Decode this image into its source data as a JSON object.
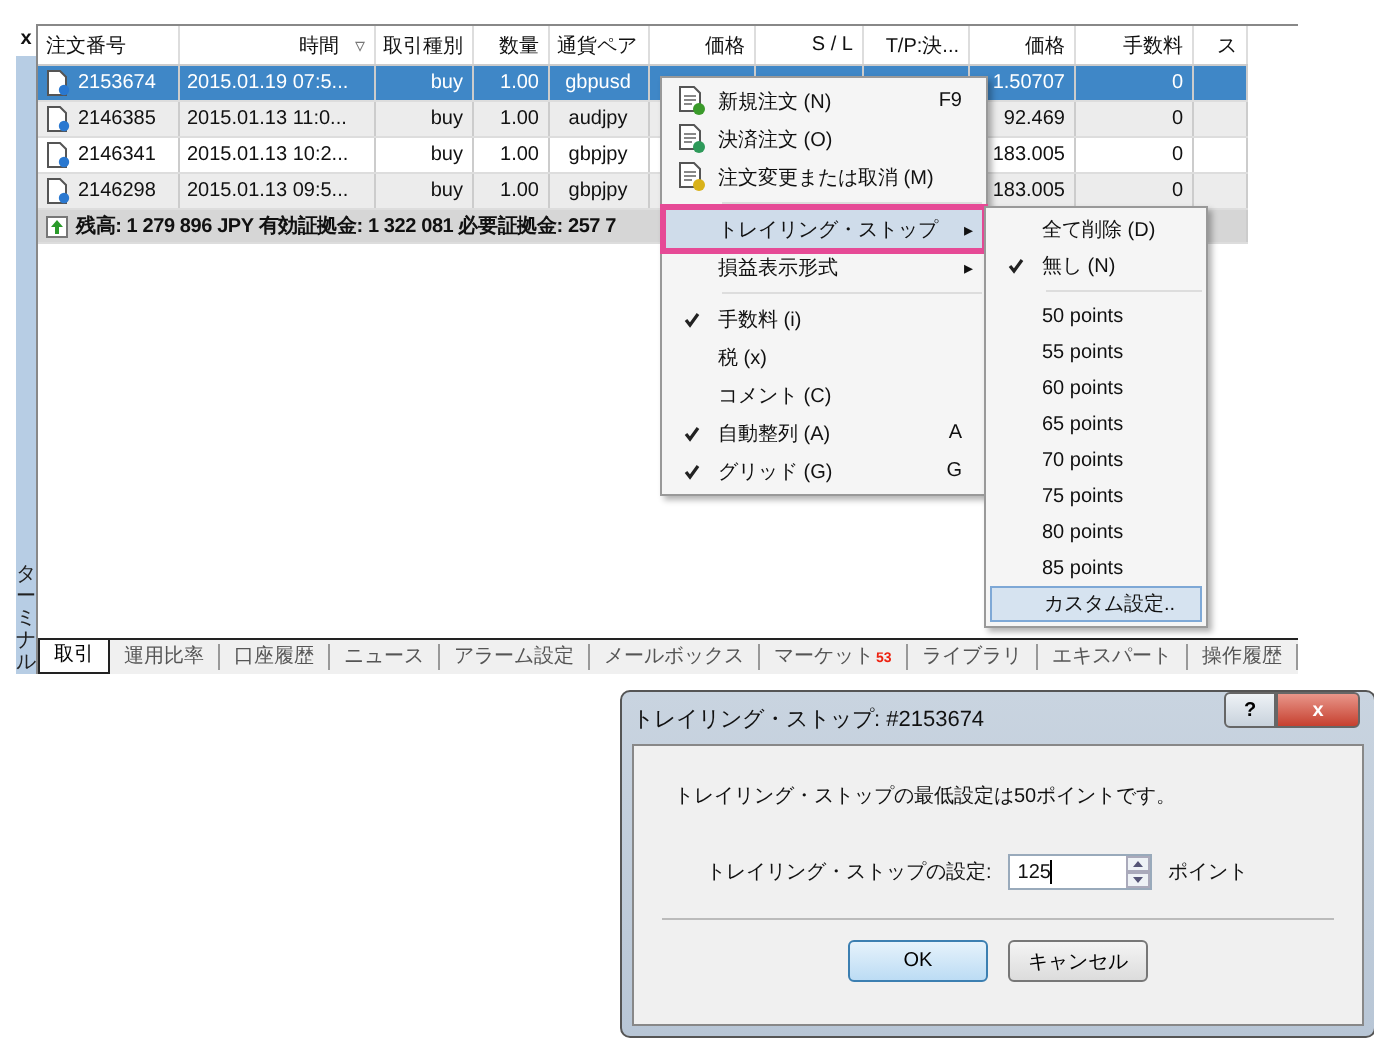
{
  "terminal": {
    "close": "x",
    "side_title": "ターミナル",
    "columns": [
      {
        "label": "注文番号"
      },
      {
        "label": "時間",
        "sort_mark": "▿"
      },
      {
        "label": "取引種別"
      },
      {
        "label": "数量"
      },
      {
        "label": "通貨ペア"
      },
      {
        "label": "価格"
      },
      {
        "label": "S / L"
      },
      {
        "label": "T/P:決..."
      },
      {
        "label": "価格"
      },
      {
        "label": "手数料"
      },
      {
        "label": "ス"
      }
    ],
    "rows": [
      {
        "id": "2153674",
        "time": "2015.01.19 07:5...",
        "type": "buy",
        "volume": "1.00",
        "symbol": "gbpusd",
        "price": "1.50707",
        "commission": "0",
        "selected": true
      },
      {
        "id": "2146385",
        "time": "2015.01.13 11:0...",
        "type": "buy",
        "volume": "1.00",
        "symbol": "audjpy",
        "price": "92.469",
        "commission": "0",
        "selected": false
      },
      {
        "id": "2146341",
        "time": "2015.01.13 10:2...",
        "type": "buy",
        "volume": "1.00",
        "symbol": "gbpjpy",
        "price": "183.005",
        "commission": "0",
        "selected": false
      },
      {
        "id": "2146298",
        "time": "2015.01.13 09:5...",
        "type": "buy",
        "volume": "1.00",
        "symbol": "gbpjpy",
        "price": "183.005",
        "commission": "0",
        "selected": false
      }
    ],
    "balance": "残高: 1 279 896 JPY  有効証拠金: 1 322 081  必要証拠金: 257 7",
    "tabs": [
      {
        "label": "取引",
        "selected": true
      },
      {
        "label": "運用比率",
        "selected": false
      },
      {
        "label": "口座履歴",
        "selected": false
      },
      {
        "label": "ニュース",
        "selected": false
      },
      {
        "label": "アラーム設定",
        "selected": false
      },
      {
        "label": "メールボックス",
        "selected": false
      },
      {
        "label": "マーケット",
        "badge": "53",
        "selected": false
      },
      {
        "label": "ライブラリ",
        "selected": false
      },
      {
        "label": "エキスパート",
        "selected": false
      },
      {
        "label": "操作履歴",
        "selected": false
      }
    ]
  },
  "context_menu": [
    {
      "kind": "command",
      "label": "新規注文 (N)",
      "shortcut": "F9",
      "checked": false,
      "selected": false
    },
    {
      "kind": "command",
      "label": "決済注文 (O)",
      "checked": false,
      "selected": false
    },
    {
      "kind": "command",
      "label": "注文変更または取消 (M)",
      "checked": false,
      "selected": false
    },
    {
      "kind": "separator"
    },
    {
      "kind": "submenu",
      "label": "トレイリング・ストップ",
      "arrow": "▸",
      "checked": false,
      "selected": true
    },
    {
      "kind": "submenu",
      "label": "損益表示形式",
      "arrow": "▸",
      "checked": false,
      "selected": false
    },
    {
      "kind": "separator"
    },
    {
      "kind": "command",
      "label": "手数料 (i)",
      "checked": true,
      "selected": false
    },
    {
      "kind": "command",
      "label": "税 (x)",
      "checked": false,
      "selected": false
    },
    {
      "kind": "command",
      "label": "コメント (C)",
      "checked": false,
      "selected": false
    },
    {
      "kind": "command",
      "label": "自動整列 (A)",
      "shortcut": "A",
      "checked": true,
      "selected": false
    },
    {
      "kind": "command",
      "label": "グリッド (G)",
      "shortcut": "G",
      "checked": true,
      "selected": false
    }
  ],
  "submenu": [
    {
      "kind": "command",
      "label": "全て削除 (D)",
      "checked": false,
      "selected": false
    },
    {
      "kind": "command",
      "label": "無し (N)",
      "checked": true,
      "selected": false
    },
    {
      "kind": "separator"
    },
    {
      "kind": "command",
      "label": "50 points",
      "checked": false,
      "selected": false
    },
    {
      "kind": "command",
      "label": "55 points",
      "checked": false,
      "selected": false
    },
    {
      "kind": "command",
      "label": "60 points",
      "checked": false,
      "selected": false
    },
    {
      "kind": "command",
      "label": "65 points",
      "checked": false,
      "selected": false
    },
    {
      "kind": "command",
      "label": "70 points",
      "checked": false,
      "selected": false
    },
    {
      "kind": "command",
      "label": "75 points",
      "checked": false,
      "selected": false
    },
    {
      "kind": "command",
      "label": "80 points",
      "checked": false,
      "selected": false
    },
    {
      "kind": "command",
      "label": "85 points",
      "checked": false,
      "selected": false
    },
    {
      "kind": "command",
      "label": "カスタム設定..",
      "checked": false,
      "selected": true
    }
  ],
  "dialog": {
    "title": "トレイリング・ストップ:  #2153674",
    "help": "?",
    "close": "x",
    "message": "トレイリング・ストップの最低設定は50ポイントです。",
    "field_label": "トレイリング・ストップの設定:",
    "value": "125",
    "unit": "ポイント",
    "buttons": [
      {
        "label": "OK",
        "default": true
      },
      {
        "label": "キャンセル",
        "default": false
      }
    ]
  }
}
